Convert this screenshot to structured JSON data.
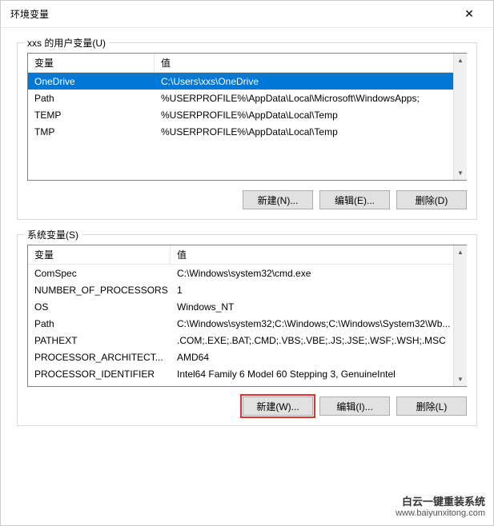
{
  "window": {
    "title": "环境变量"
  },
  "user_section": {
    "label": "xxs 的用户变量(U)",
    "columns": {
      "variable": "变量",
      "value": "值"
    },
    "rows": [
      {
        "name": "OneDrive",
        "value": "C:\\Users\\xxs\\OneDrive",
        "selected": true
      },
      {
        "name": "Path",
        "value": "%USERPROFILE%\\AppData\\Local\\Microsoft\\WindowsApps;",
        "selected": false
      },
      {
        "name": "TEMP",
        "value": "%USERPROFILE%\\AppData\\Local\\Temp",
        "selected": false
      },
      {
        "name": "TMP",
        "value": "%USERPROFILE%\\AppData\\Local\\Temp",
        "selected": false
      }
    ],
    "buttons": {
      "new": "新建(N)...",
      "edit": "编辑(E)...",
      "delete": "删除(D)"
    }
  },
  "system_section": {
    "label": "系统变量(S)",
    "columns": {
      "variable": "变量",
      "value": "值"
    },
    "rows": [
      {
        "name": "ComSpec",
        "value": "C:\\Windows\\system32\\cmd.exe"
      },
      {
        "name": "NUMBER_OF_PROCESSORS",
        "value": "1"
      },
      {
        "name": "OS",
        "value": "Windows_NT"
      },
      {
        "name": "Path",
        "value": "C:\\Windows\\system32;C:\\Windows;C:\\Windows\\System32\\Wb..."
      },
      {
        "name": "PATHEXT",
        "value": ".COM;.EXE;.BAT;.CMD;.VBS;.VBE;.JS;.JSE;.WSF;.WSH;.MSC"
      },
      {
        "name": "PROCESSOR_ARCHITECT...",
        "value": "AMD64"
      },
      {
        "name": "PROCESSOR_IDENTIFIER",
        "value": "Intel64 Family 6 Model 60 Stepping 3, GenuineIntel"
      }
    ],
    "buttons": {
      "new": "新建(W)...",
      "edit": "编辑(I)...",
      "delete": "删除(L)"
    }
  },
  "watermark": {
    "line1": "白云一键重装系统",
    "line2": "www.baiyunxitong.com"
  }
}
